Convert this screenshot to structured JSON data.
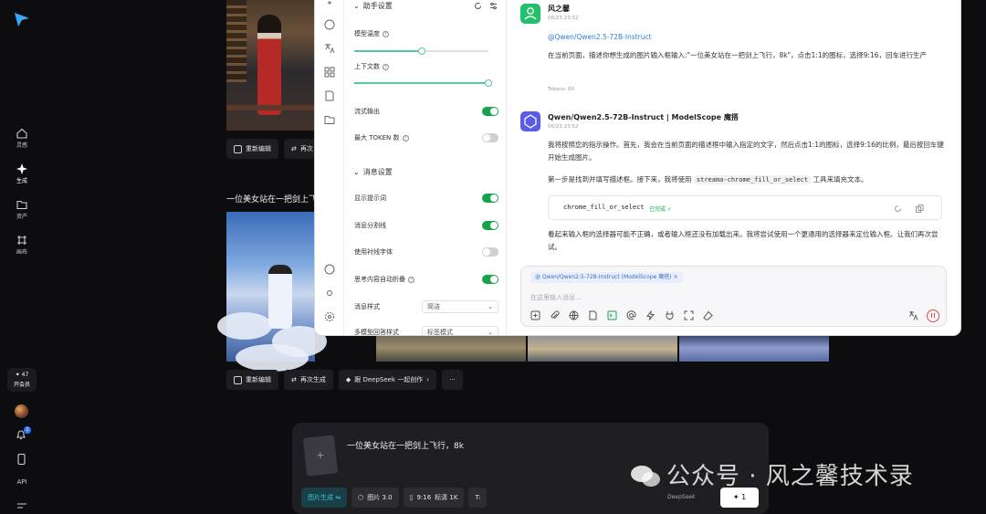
{
  "rail": {
    "nav": [
      {
        "label": "灵感"
      },
      {
        "label": "生成"
      },
      {
        "label": "资产"
      },
      {
        "label": "画布"
      }
    ],
    "credits_count": "✦ 47",
    "credits_label": "开会员",
    "notification_count": "1",
    "api_label": "API"
  },
  "feed": {
    "actions_top": {
      "edit": "重新编辑",
      "regenerate": "再次"
    },
    "prompt_title": "一位美女站在一把剑上飞",
    "actions_bottom": {
      "edit": "重新编辑",
      "regenerate": "再次生成",
      "deepseek": "跟 DeepSeek 一起创作",
      "more": "···"
    }
  },
  "composer": {
    "prompt": "一位美女站在一把剑上飞行，8k",
    "thumb_icon": "+",
    "mode": "图片生成 ⇋",
    "model": "图片 3.0",
    "ratio": "9:16",
    "quality": "标清 1K",
    "brand": "DeepSeek",
    "send_label": "✦ 1"
  },
  "watermark": "公众号 · 风之馨技术录",
  "settings": {
    "assistant_header": "助手设置",
    "model_temp": "模型温度",
    "context_count": "上下文数",
    "temperature_level": 0.5,
    "context_level": 1.0,
    "stream": "流式输出",
    "max_tokens": "最大 TOKEN 数",
    "message_header": "消息设置",
    "show_prompt": "显示提示词",
    "msg_divider": "消息分割线",
    "serif_font": "使用衬线字体",
    "auto_fold": "思考内容自动折叠",
    "msg_style": "消息样式",
    "msg_style_value": "简洁",
    "multi_model": "多模型回答样式",
    "multi_model_value": "标签模式",
    "toggles": {
      "stream": true,
      "max_tokens": false,
      "show_prompt": true,
      "msg_divider": true,
      "serif_font": false,
      "auto_fold": true
    }
  },
  "chat": {
    "user_name": "风之馨",
    "user_time": "06/23 23:52",
    "user_mention": "@Qwen/Qwen2.5-72B-Instruct",
    "user_text": "在当前页面，描述你想生成的图片输入框输入:\"一位美女站在一把剑上飞行，8k\"，点击1:1的图标，选择9:16，回车进行生产",
    "tokens": "Tokens: 60",
    "bot_name": "Qwen/Qwen2.5-72B-Instruct | ModelScope 魔搭",
    "bot_time": "06/23 23:52",
    "bot_p1": "我将按照您的指示操作。首先，我会在当前页面的描述框中输入指定的文字，然后点击1:1的图标，选择9:16的比例，最后按回车键开始生成图片。",
    "bot_p2_a": "第一步是找到并填写描述框。接下来，我将使用",
    "bot_p2_code": "streama-chrome_fill_or_select",
    "bot_p2_b": "工具来填充文本。",
    "tool_name": "chrome_fill_or_select",
    "tool_status": "已完成 ✓",
    "bot_p3": "看起来输入框的选择器可能不正确，或者输入框还没有加载出来。我将尝试使用一个更通用的选择器来定位输入框。让我们再次尝试。",
    "input_tag": "@ Qwen/Qwen2.5-72B-Instruct (ModelScope 魔搭) ×",
    "input_placeholder": "在这里输入消息..."
  },
  "colors": {
    "accent_green": "#16a34a",
    "accent_teal": "#39c5d3",
    "link_blue": "#2a7cd8",
    "stop_red": "#e04a3b"
  }
}
